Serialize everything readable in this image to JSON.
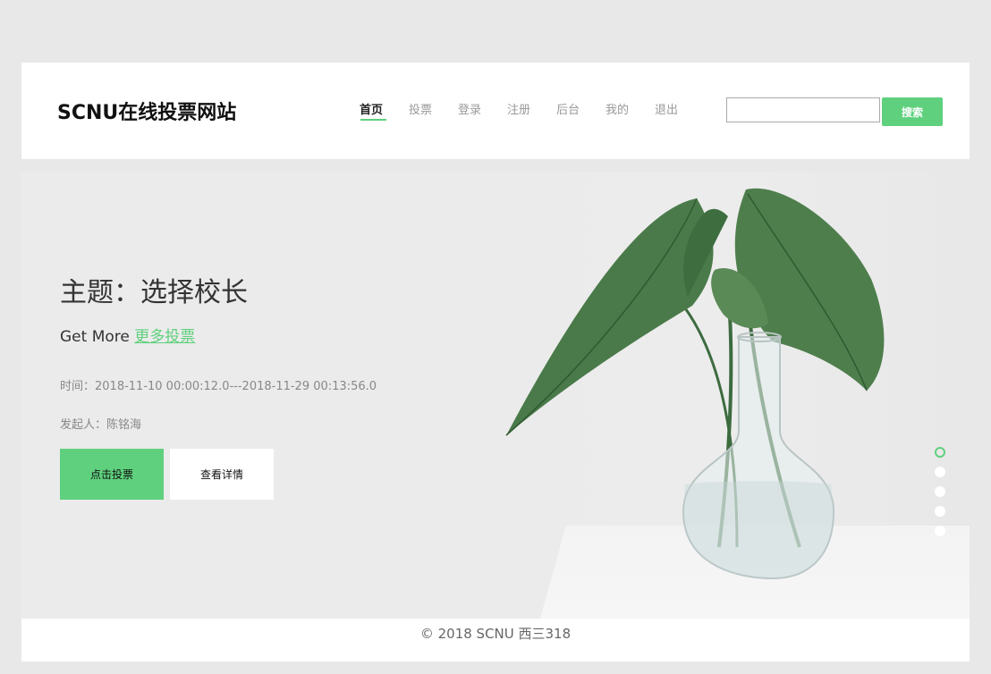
{
  "header": {
    "logo": "SCNU在线投票网站",
    "nav": [
      {
        "label": "首页",
        "active": true
      },
      {
        "label": "投票"
      },
      {
        "label": "登录"
      },
      {
        "label": "注册"
      },
      {
        "label": "后台"
      },
      {
        "label": "我的"
      },
      {
        "label": "退出"
      }
    ],
    "search": {
      "value": "",
      "placeholder": "",
      "button_label": "搜索"
    }
  },
  "hero": {
    "title": "主题：选择校长",
    "sub_prefix": "Get More ",
    "sub_link": "更多投票",
    "time": "时间：2018-11-10 00:00:12.0---2018-11-29 00:13:56.0",
    "author": "发起人：陈铭海",
    "vote_button": "点击投票",
    "detail_button": "查看详情",
    "slides": 5,
    "active_slide": 1
  },
  "footer": {
    "text": "© 2018 SCNU 西三318"
  },
  "colors": {
    "accent": "#5fd07d",
    "background": "#e8e8e8"
  }
}
